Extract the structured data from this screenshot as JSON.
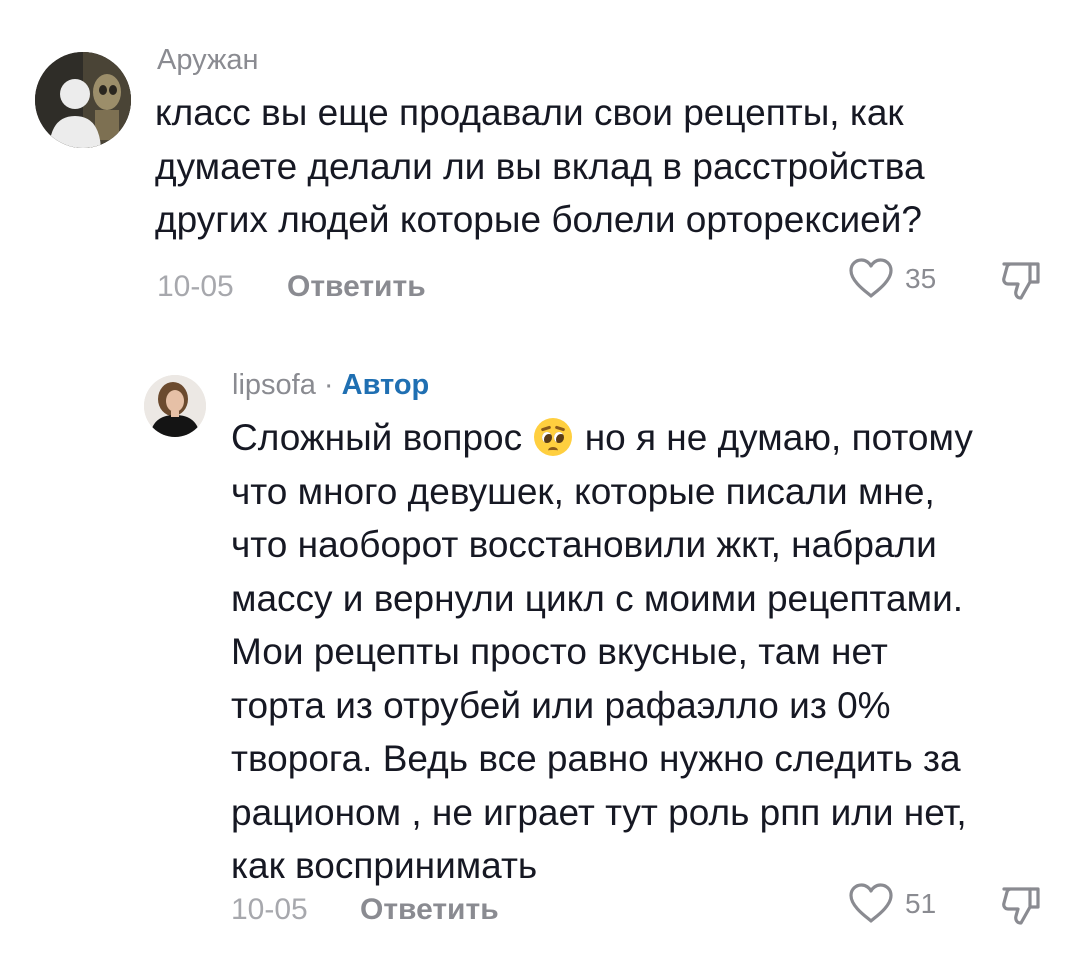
{
  "comments": [
    {
      "username": "Аружан",
      "is_author": false,
      "lines": [
        "класс вы еще продавали свои рецепты, как",
        "думаете делали ли вы вклад в расстройства",
        "других людей которые болели орторексией?"
      ],
      "date": "10-05",
      "reply_label": "Ответить",
      "likes": "35",
      "icons": {
        "like": "heart-icon",
        "dislike": "thumbs-down-icon"
      }
    },
    {
      "username": "lipsofa",
      "separator": "·",
      "author_badge": "Автор",
      "is_author": true,
      "first_line_before_emoji": "Сложный вопрос",
      "emoji": "🥺",
      "first_line_after_emoji": "но я не думаю, потому",
      "lines": [
        "что много девушек, которые писали мне,",
        "что наоборот восстановили жкт, набрали",
        "массу и вернули цикл с моими рецептами.",
        "Мои рецепты просто вкусные, там нет",
        "торта из отрубей или рафаэлло из 0%",
        "творога. Ведь все равно нужно следить за",
        "рационом , не играет тут роль рпп или нет,",
        "как воспринимать"
      ],
      "date": "10-05",
      "reply_label": "Ответить",
      "likes": "51",
      "icons": {
        "like": "heart-icon",
        "dislike": "thumbs-down-icon"
      }
    }
  ],
  "colors": {
    "text": "#161823",
    "secondary": "#8a8b91",
    "date": "#a7a8ad",
    "author_badge": "#1f6fb2"
  }
}
